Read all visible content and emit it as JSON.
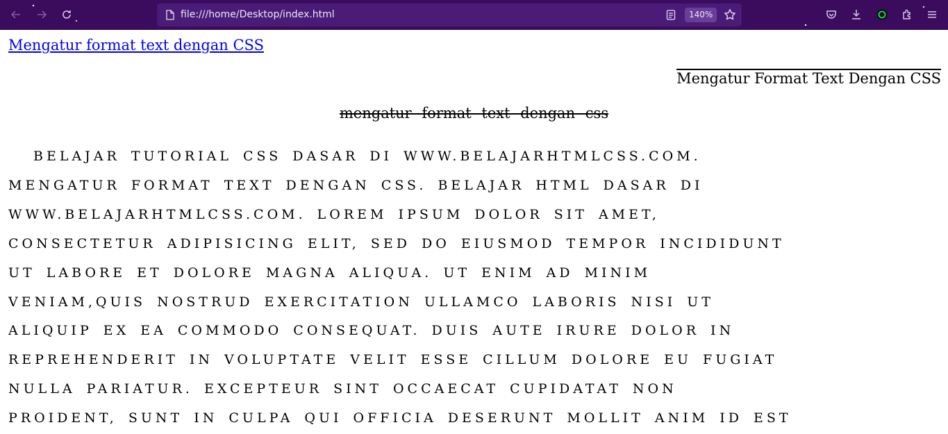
{
  "browser": {
    "url": "file:///home/Desktop/index.html",
    "zoom": "140%",
    "icons": [
      "back-icon",
      "forward-icon",
      "reload-icon",
      "page-icon",
      "reader-view-icon",
      "bookmark-star-icon",
      "pocket-icon",
      "download-icon",
      "extension-account-icon",
      "extensions-icon",
      "menu-icon"
    ]
  },
  "page": {
    "link_heading": "Mengatur format text dengan CSS",
    "overline_heading": "Mengatur Format Text Dengan CSS",
    "strike_heading": "mengatur format text dengan css",
    "paragraph_lines": [
      "Belajar tutorial CSS dasar di www.belajarhtmlcss.com.",
      "Mengatur format text dengan CSS. Belajar HTML dasar di",
      "www.belajarhtmlcss.com. Lorem ipsum dolor sit amet,",
      "consectetur adipisicing elit, sed do eiusmod tempor incididunt",
      "ut labore et dolore magna aliqua. Ut enim ad minim",
      "veniam,quis nostrud exercitation ullamco laboris nisi ut",
      "aliquip ex ea commodo consequat. Duis aute irure dolor in",
      "reprehenderit in voluptate velit esse cillum dolore eu fugiat",
      "nulla pariatur. Excepteur sint occaecat cupidatat non",
      "proident, sunt in culpa qui officia deserunt mollit anim id est"
    ]
  },
  "colors": {
    "toolbar_bg": "#3b0b5e",
    "urlbar_bg": "#4a1c78",
    "link": "#0000ee"
  }
}
